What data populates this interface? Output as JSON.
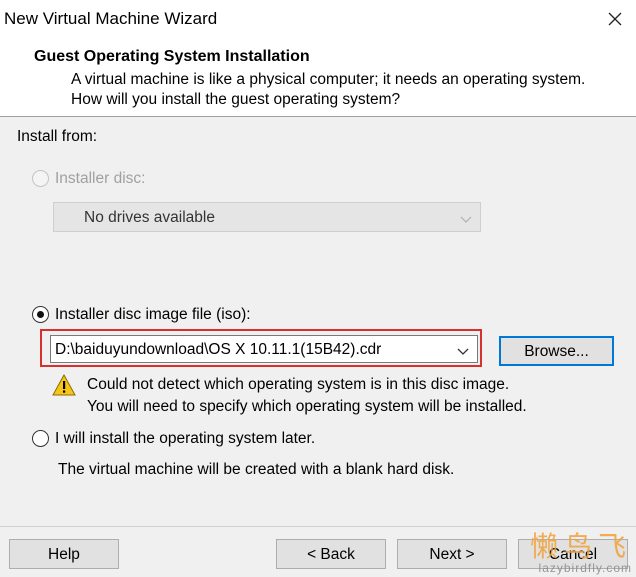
{
  "window": {
    "title": "New Virtual Machine Wizard",
    "close_icon": "close-icon"
  },
  "header": {
    "title": "Guest Operating System Installation",
    "description": "A virtual machine is like a physical computer; it needs an operating system. How will you install the guest operating system?"
  },
  "install_from": {
    "label": "Install from:",
    "installer_disc": {
      "label": "Installer disc:",
      "selected": false,
      "enabled": false,
      "dropdown_value": "No drives available"
    },
    "iso": {
      "label": "Installer disc image file (iso):",
      "selected": true,
      "path_value": "D:\\baiduyundownload\\OS X 10.11.1(15B42).cdr",
      "browse_label": "Browse...",
      "warning_icon": "warning-icon",
      "warning_line1": "Could not detect which operating system is in this disc image.",
      "warning_line2": "You will need to specify which operating system will be installed."
    },
    "later": {
      "label": "I will install the operating system later.",
      "selected": false,
      "description": "The virtual machine will be created with a blank hard disk."
    }
  },
  "footer": {
    "help_label": "Help",
    "back_label": "< Back",
    "next_label": "Next >",
    "cancel_label": "Cancel"
  },
  "watermark": {
    "text": "懒鸟飞",
    "url": "lazybirdfly.com"
  },
  "colors": {
    "highlight_border": "#d8302c",
    "focus_blue": "#0078d7",
    "warning_yellow": "#f5c518"
  }
}
